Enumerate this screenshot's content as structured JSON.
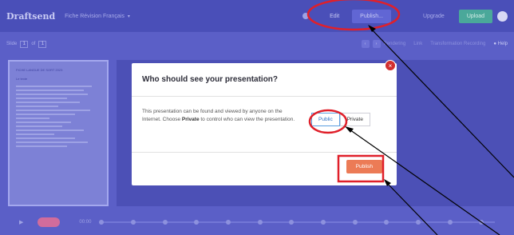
{
  "app": {
    "brand": "Draftsend",
    "doc_title": "Fiche Révision Français",
    "caret": "▾"
  },
  "topbar": {
    "edit_label": "Edit",
    "publish_label": "Publish...",
    "upgrade_label": "Upgrade",
    "upload_label": "Upload"
  },
  "subbar": {
    "slide_label": "Slide",
    "slide_current": "1",
    "slide_of": "of",
    "slide_total": "1",
    "text_1": "Rendering",
    "text_2": "Link",
    "text_3": "Transformation Recording",
    "help_label": "Help"
  },
  "thumbnail": {
    "title": "FICHE LANGUE DE SORT 2023",
    "subtitle": "Le texte"
  },
  "timeline": {
    "time": "00:00"
  },
  "modal": {
    "title": "Who should see your presentation?",
    "description_pre": "This presentation can be found and viewed by anyone on the Internet. Choose ",
    "description_bold": "Private",
    "description_post": " to control who can view the presentation.",
    "public_label": "Public",
    "private_label": "Private",
    "publish_label": "Publish",
    "close_symbol": "×"
  },
  "colors": {
    "background": "#5b5fc7",
    "topbar": "#4a4fb8",
    "publish": "#ec7b56",
    "annotation": "#e0202a",
    "upload": "#4aa89a"
  }
}
